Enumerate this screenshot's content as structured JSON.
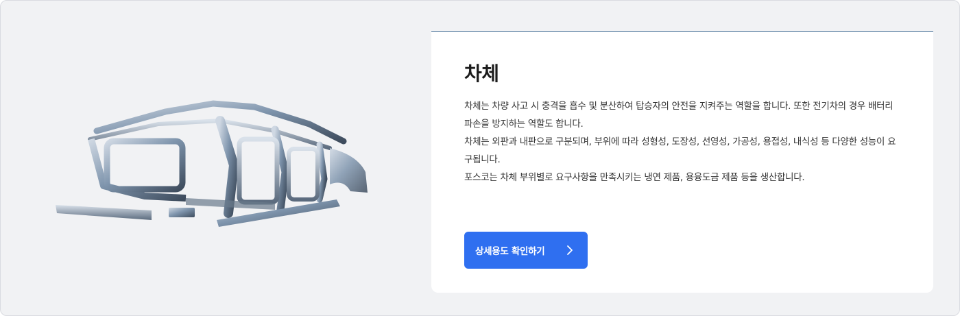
{
  "section": {
    "title": "차체",
    "paragraphs": [
      "차체는 차량 사고 시 충격을 흡수 및 분산하여 탑승자의 안전을 지켜주는 역할을 합니다. 또한 전기차의 경우 배터리 파손을 방지하는 역할도 합니다.",
      "차체는 외판과 내판으로 구분되며, 부위에 따라 성형성, 도장성, 선영성, 가공성, 용접성, 내식성 등 다양한 성능이 요구됩니다.",
      "포스코는 차체 부위별로 요구사항을 만족시키는 냉연 제품, 용융도금 제품 등을 생산합니다."
    ],
    "cta_label": "상세용도 확인하기",
    "cta_icon": "chevron-right-icon",
    "image_subject": "car-body-frame"
  },
  "colors": {
    "page_bg": "#f1f2f4",
    "card_bg": "#ffffff",
    "accent_line": "#2e5c88",
    "button": "#2f6ff0"
  }
}
